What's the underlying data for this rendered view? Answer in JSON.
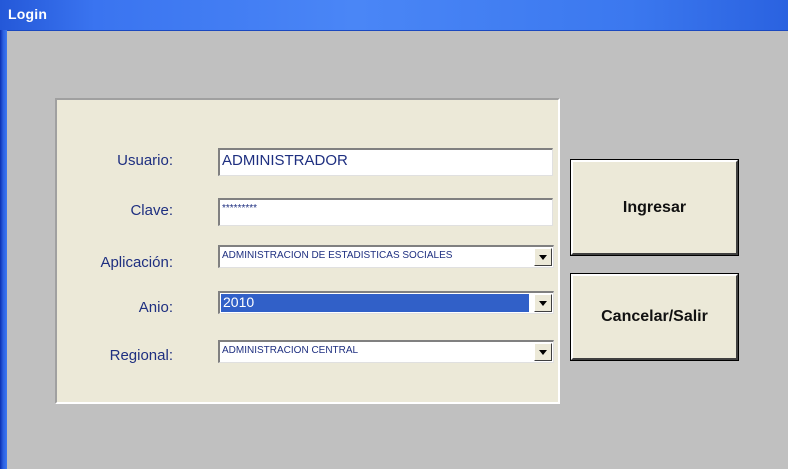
{
  "window": {
    "title": "Login"
  },
  "form": {
    "usuario": {
      "label": "Usuario:",
      "value": "ADMINISTRADOR"
    },
    "clave": {
      "label": "Clave:",
      "value": "*********"
    },
    "aplicacion": {
      "label": "Aplicación:",
      "value": "ADMINISTRACION DE ESTADISTICAS SOCIALES"
    },
    "anio": {
      "label": "Anio:",
      "value": "2010"
    },
    "regional": {
      "label": "Regional:",
      "value": "ADMINISTRACION CENTRAL"
    }
  },
  "buttons": {
    "ingresar": "Ingresar",
    "cancelar": "Cancelar/Salir"
  },
  "colors": {
    "label_text": "#1e2f80",
    "panel": "#ece9d8",
    "window_bg": "#c0c0c0",
    "titlebar": "#3a74f0",
    "selection": "#3160c8"
  },
  "icons": {
    "dropdown": "chevron-down-icon"
  }
}
